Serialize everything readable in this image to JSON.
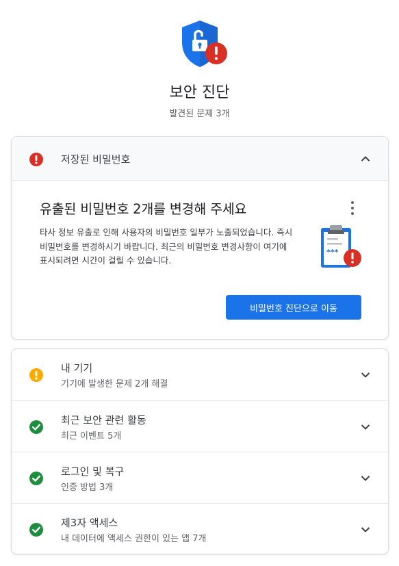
{
  "header": {
    "title": "보안 진단",
    "subtitle": "발견된 문제 3개"
  },
  "password_section": {
    "label": "저장된 비밀번호",
    "status": "error",
    "heading": "유출된 비밀번호 2개를 변경해 주세요",
    "description": "타사 정보 유출로 인해 사용자의 비밀번호 일부가 노출되었습니다. 즉시 비밀번호를 변경하시기 바랍니다. 최근의 비밀번호 변경사항이 여기에 표시되려면 시간이 걸릴 수 있습니다.",
    "button_label": "비밀번호 진단으로 이동"
  },
  "sections": [
    {
      "title": "내 기기",
      "subtitle": "기기에 발생한 문제 2개 해결",
      "status": "warning"
    },
    {
      "title": "최근 보안 관련 활동",
      "subtitle": "최근 이벤트 5개",
      "status": "ok"
    },
    {
      "title": "로그인 및 복구",
      "subtitle": "인증 방법 3개",
      "status": "ok"
    },
    {
      "title": "제3자 액세스",
      "subtitle": "내 데이터에 액세스 권한이 있는 앱 7개",
      "status": "ok"
    }
  ],
  "colors": {
    "accent": "#1a73e8",
    "error": "#d93025",
    "warning": "#f9ab00",
    "ok": "#1e8e3e",
    "shield": "#1a73e8"
  },
  "icons": {
    "hero": "shield-lock-alert-icon",
    "clipboard": "password-clipboard-alert-icon",
    "error": "error-icon",
    "warning": "warning-icon",
    "ok": "check-circle-icon",
    "more": "more-vert-icon",
    "collapse": "chevron-up-icon",
    "expand": "chevron-down-icon"
  }
}
